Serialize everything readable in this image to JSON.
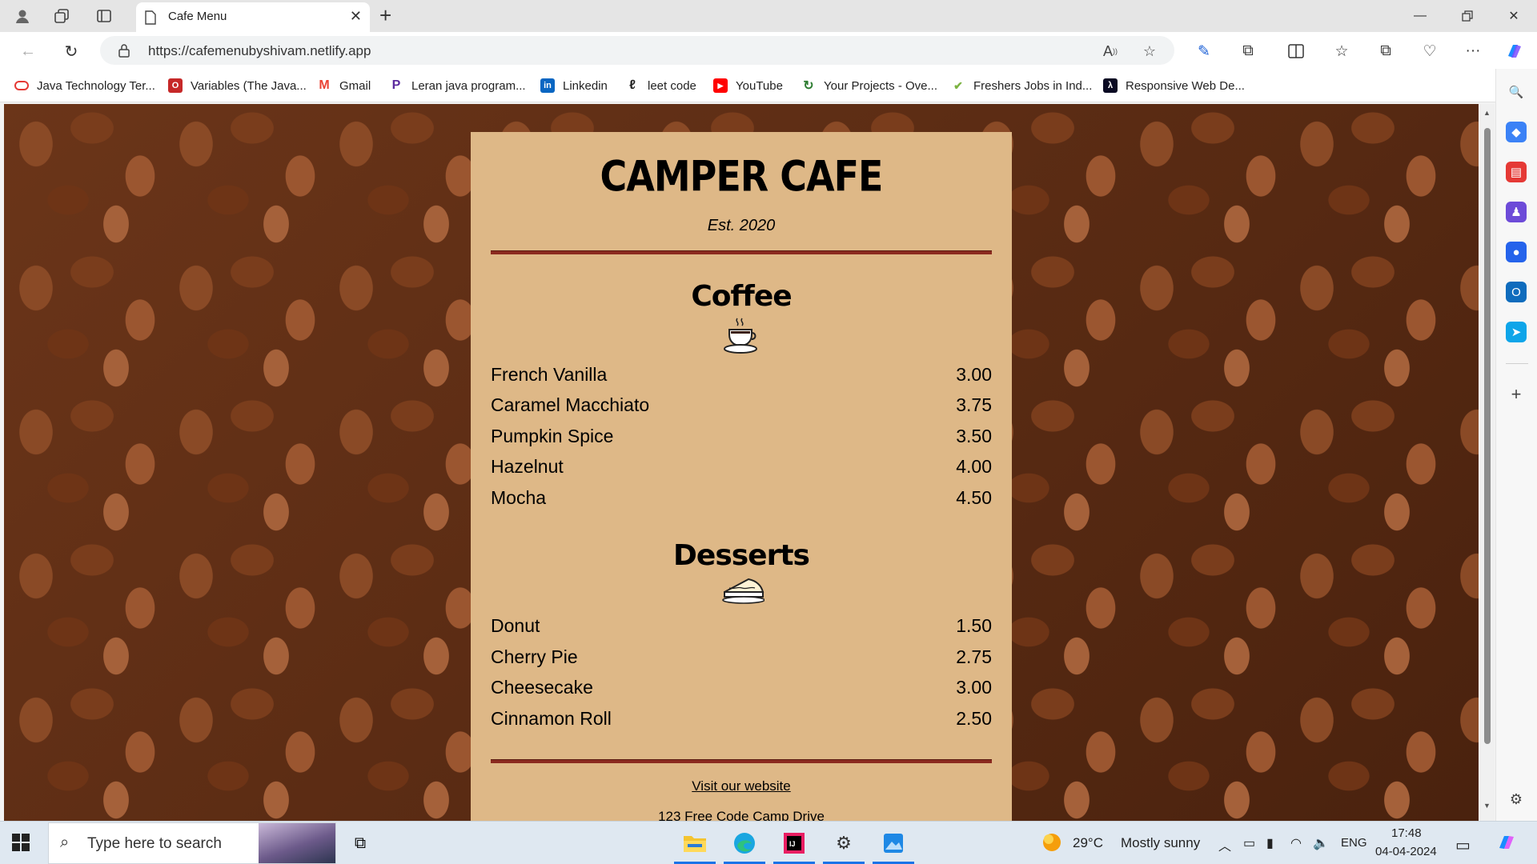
{
  "browser": {
    "tab_title": "Cafe Menu",
    "url": "https://cafemenubyshivam.netlify.app"
  },
  "bookmarks": [
    {
      "label": "Java Technology Ter...",
      "icon": "java-icon",
      "color": "#e53935"
    },
    {
      "label": "Variables (The Java...",
      "icon": "oracle-icon",
      "color": "#c62828"
    },
    {
      "label": "Gmail",
      "icon": "gmail-icon",
      "color": "#ea4335"
    },
    {
      "label": "Leran java program...",
      "icon": "programiz-icon",
      "color": "#5b2a9e"
    },
    {
      "label": "Linkedin",
      "icon": "linkedin-icon",
      "color": "#0a66c2"
    },
    {
      "label": "leet code",
      "icon": "leetcode-icon",
      "color": "#f89f1b"
    },
    {
      "label": "YouTube",
      "icon": "youtube-icon",
      "color": "#ff0000"
    },
    {
      "label": "Your Projects - Ove...",
      "icon": "projects-icon",
      "color": "#2e7d32"
    },
    {
      "label": "Freshers Jobs in Ind...",
      "icon": "jobs-icon",
      "color": "#7cb342"
    },
    {
      "label": "Responsive Web De...",
      "icon": "freecodecamp-icon",
      "color": "#0a0a23"
    }
  ],
  "menu": {
    "title": "CAMPER CAFE",
    "established": "Est. 2020",
    "sections": [
      {
        "title": "Coffee",
        "icon": "coffee-cup-icon",
        "items": [
          {
            "name": "French Vanilla",
            "price": "3.00"
          },
          {
            "name": "Caramel Macchiato",
            "price": "3.75"
          },
          {
            "name": "Pumpkin Spice",
            "price": "3.50"
          },
          {
            "name": "Hazelnut",
            "price": "4.00"
          },
          {
            "name": "Mocha",
            "price": "4.50"
          }
        ]
      },
      {
        "title": "Desserts",
        "icon": "pie-icon",
        "items": [
          {
            "name": "Donut",
            "price": "1.50"
          },
          {
            "name": "Cherry Pie",
            "price": "2.75"
          },
          {
            "name": "Cheesecake",
            "price": "3.00"
          },
          {
            "name": "Cinnamon Roll",
            "price": "2.50"
          }
        ]
      }
    ],
    "footer_link": "Visit our website",
    "address": "123 Free Code Camp Drive"
  },
  "taskbar": {
    "search_placeholder": "Type here to search",
    "weather_temp": "29°C",
    "weather_text": "Mostly sunny",
    "language": "ENG",
    "time": "17:48",
    "date": "04-04-2024"
  },
  "colors": {
    "menu_background": "#deb887",
    "divider": "#8b2a1f"
  }
}
